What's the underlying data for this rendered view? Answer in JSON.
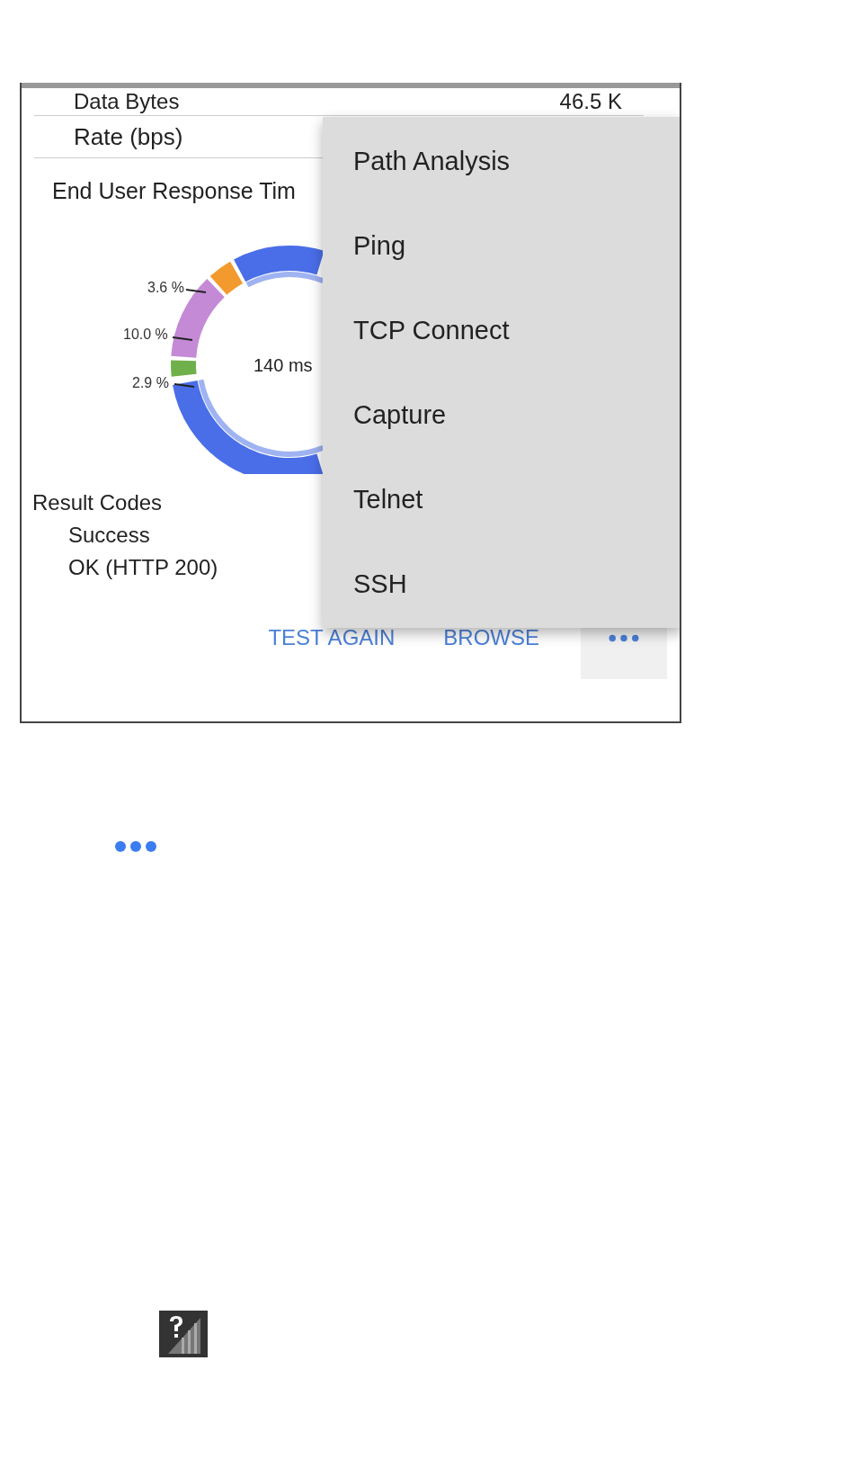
{
  "screen": {
    "rows": [
      {
        "label": "Data Bytes",
        "value": "46.5 K"
      },
      {
        "label": "Rate (bps)"
      }
    ],
    "chart": {
      "title": "End User Response Tim",
      "center": "140 ms",
      "segment_labels": [
        "3.6 %",
        "10.0 %",
        "2.9 %"
      ]
    },
    "result_codes": {
      "heading": "Result Codes",
      "lines": [
        "Success",
        "OK (HTTP 200)"
      ]
    },
    "actions": [
      "TEST AGAIN",
      "BROWSE"
    ],
    "menu": [
      "Path Analysis",
      "Ping",
      "TCP Connect",
      "Capture",
      "Telnet",
      "SSH"
    ]
  }
}
